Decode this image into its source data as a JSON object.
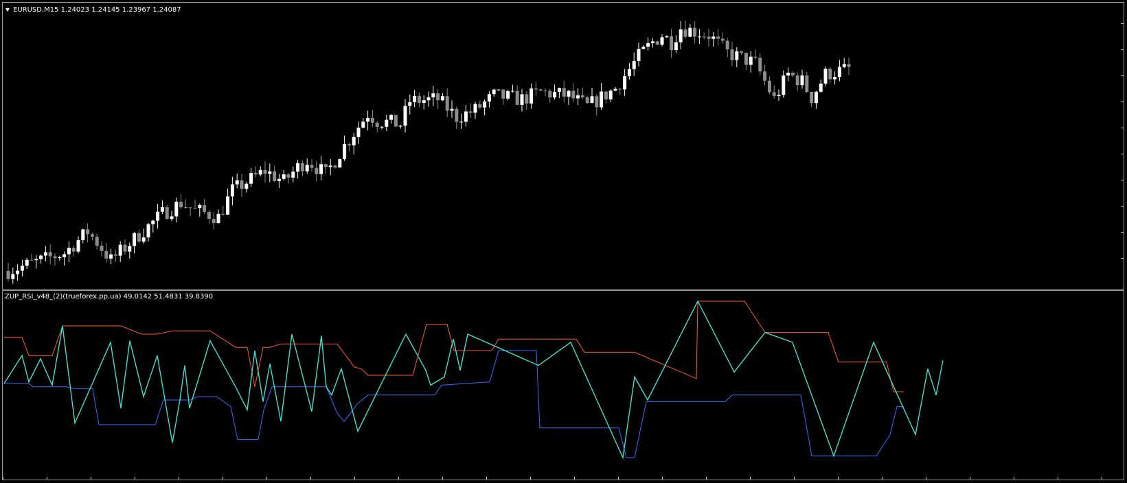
{
  "main_chart": {
    "symbol_line": "EURUSD,M15  1.24023 1.24145 1.23967 1.24087",
    "arrow_icon": "triangle-down-icon"
  },
  "indicator": {
    "title_line": "ZUP_RSI_v48_(2)(trueforex.pp.ua) 49.0142 51.4831 39.8390"
  },
  "colors": {
    "background": "#000000",
    "frame": "#9a9a9a",
    "bull_candle": "#ffffff",
    "bear_candle": "#8c8c8c",
    "rsi_line": "#40e0d0",
    "upper_band": "#ff5a2a",
    "lower_band": "#3a6bff"
  },
  "chart_data": [
    {
      "type": "candlestick",
      "anchors": [
        [
          0,
          1.233
        ],
        [
          12,
          1.234
        ],
        [
          17,
          1.2352
        ],
        [
          19,
          1.2346
        ],
        [
          22,
          1.2336
        ],
        [
          33,
          1.2362
        ],
        [
          37,
          1.2368
        ],
        [
          40,
          1.2364
        ],
        [
          45,
          1.236
        ],
        [
          48,
          1.2375
        ],
        [
          55,
          1.2386
        ],
        [
          59,
          1.238
        ],
        [
          62,
          1.2388
        ],
        [
          64,
          1.2392
        ],
        [
          68,
          1.2384
        ],
        [
          72,
          1.24
        ],
        [
          77,
          1.2418
        ],
        [
          79,
          1.2414
        ],
        [
          84,
          1.2412
        ],
        [
          86,
          1.2425
        ],
        [
          92,
          1.2426
        ],
        [
          96,
          1.2416
        ],
        [
          100,
          1.242
        ],
        [
          104,
          1.2428
        ],
        [
          110,
          1.2426
        ],
        [
          114,
          1.243
        ],
        [
          120,
          1.2428
        ],
        [
          124,
          1.2422
        ],
        [
          130,
          1.2432
        ],
        [
          135,
          1.245
        ],
        [
          138,
          1.2458
        ],
        [
          140,
          1.2462
        ],
        [
          142,
          1.2458
        ],
        [
          144,
          1.2466
        ],
        [
          150,
          1.2462
        ],
        [
          154,
          1.2452
        ],
        [
          160,
          1.2446
        ],
        [
          164,
          1.2426
        ],
        [
          167,
          1.244
        ],
        [
          170,
          1.2436
        ],
        [
          172,
          1.2427
        ],
        [
          175,
          1.244
        ],
        [
          180,
          1.2443
        ]
      ],
      "candle_count": 181,
      "ylim": [
        1.232,
        1.248
      ]
    },
    {
      "type": "line",
      "ylim": [
        0,
        100
      ],
      "series": [
        {
          "key": "rsi",
          "points": [
            [
              0,
              50
            ],
            [
              26,
              67
            ],
            [
              36,
              51
            ],
            [
              53,
              65
            ],
            [
              70,
              49
            ],
            [
              85,
              85
            ],
            [
              103,
              26
            ],
            [
              155,
              75
            ],
            [
              170,
              35
            ],
            [
              183,
              76
            ],
            [
              203,
              42
            ],
            [
              223,
              67
            ],
            [
              245,
              14
            ],
            [
              256,
              40
            ],
            [
              263,
              61
            ],
            [
              270,
              35
            ],
            [
              300,
              76
            ],
            [
              337,
              48
            ],
            [
              354,
              34
            ],
            [
              365,
              70
            ],
            [
              377,
              39
            ],
            [
              387,
              62
            ],
            [
              403,
              27
            ],
            [
              419,
              80
            ],
            [
              448,
              33
            ],
            [
              462,
              79
            ],
            [
              469,
              48
            ],
            [
              477,
              43
            ],
            [
              491,
              59
            ],
            [
              515,
              21
            ],
            [
              585,
              80
            ],
            [
              614,
              58
            ],
            [
              621,
              49
            ],
            [
              641,
              54
            ],
            [
              654,
              77
            ],
            [
              664,
              58
            ],
            [
              675,
              80
            ],
            [
              778,
              61
            ],
            [
              825,
              75
            ],
            [
              901,
              5
            ],
            [
              918,
              54
            ],
            [
              937,
              40
            ],
            [
              1010,
              100
            ],
            [
              1063,
              57
            ],
            [
              1108,
              81
            ],
            [
              1148,
              75
            ],
            [
              1208,
              6
            ],
            [
              1266,
              75
            ],
            [
              1327,
              19
            ],
            [
              1345,
              59
            ],
            [
              1357,
              43
            ],
            [
              1367,
              64
            ]
          ]
        },
        {
          "key": "upper",
          "points": [
            [
              0,
              78
            ],
            [
              26,
              78
            ],
            [
              36,
              67
            ],
            [
              53,
              67
            ],
            [
              70,
              67
            ],
            [
              85,
              85
            ],
            [
              170,
              85
            ],
            [
              200,
              80
            ],
            [
              223,
              80
            ],
            [
              245,
              82
            ],
            [
              300,
              82
            ],
            [
              337,
              72
            ],
            [
              354,
              72
            ],
            [
              365,
              48
            ],
            [
              377,
              72
            ],
            [
              387,
              72
            ],
            [
              403,
              74
            ],
            [
              485,
              74
            ],
            [
              510,
              60
            ],
            [
              520,
              59
            ],
            [
              530,
              55
            ],
            [
              595,
              55
            ],
            [
              615,
              86
            ],
            [
              645,
              86
            ],
            [
              655,
              70
            ],
            [
              710,
              70
            ],
            [
              720,
              77
            ],
            [
              833,
              77
            ],
            [
              845,
              69
            ],
            [
              918,
              69
            ],
            [
              1008,
              53
            ],
            [
              1010,
              100
            ],
            [
              1078,
              100
            ],
            [
              1108,
              81
            ],
            [
              1200,
              81
            ],
            [
              1215,
              63
            ],
            [
              1285,
              63
            ],
            [
              1295,
              45
            ],
            [
              1310,
              45
            ]
          ]
        },
        {
          "key": "lower",
          "points": [
            [
              0,
              50
            ],
            [
              36,
              50
            ],
            [
              42,
              48
            ],
            [
              90,
              48
            ],
            [
              102,
              47
            ],
            [
              129,
              47
            ],
            [
              138,
              25
            ],
            [
              220,
              25
            ],
            [
              232,
              40
            ],
            [
              270,
              40
            ],
            [
              281,
              42
            ],
            [
              310,
              42
            ],
            [
              330,
              36
            ],
            [
              340,
              16
            ],
            [
              370,
              16
            ],
            [
              378,
              34
            ],
            [
              390,
              48
            ],
            [
              469,
              48
            ],
            [
              485,
              32
            ],
            [
              495,
              27
            ],
            [
              515,
              38
            ],
            [
              530,
              43
            ],
            [
              627,
              43
            ],
            [
              637,
              49
            ],
            [
              707,
              51
            ],
            [
              720,
              70
            ],
            [
              775,
              70
            ],
            [
              780,
              23
            ],
            [
              895,
              23
            ],
            [
              906,
              5
            ],
            [
              918,
              5
            ],
            [
              935,
              39
            ],
            [
              1050,
              39
            ],
            [
              1060,
              43
            ],
            [
              1160,
              43
            ],
            [
              1176,
              6
            ],
            [
              1270,
              6
            ],
            [
              1290,
              19
            ],
            [
              1300,
              36
            ],
            [
              1310,
              36
            ]
          ]
        }
      ]
    }
  ]
}
